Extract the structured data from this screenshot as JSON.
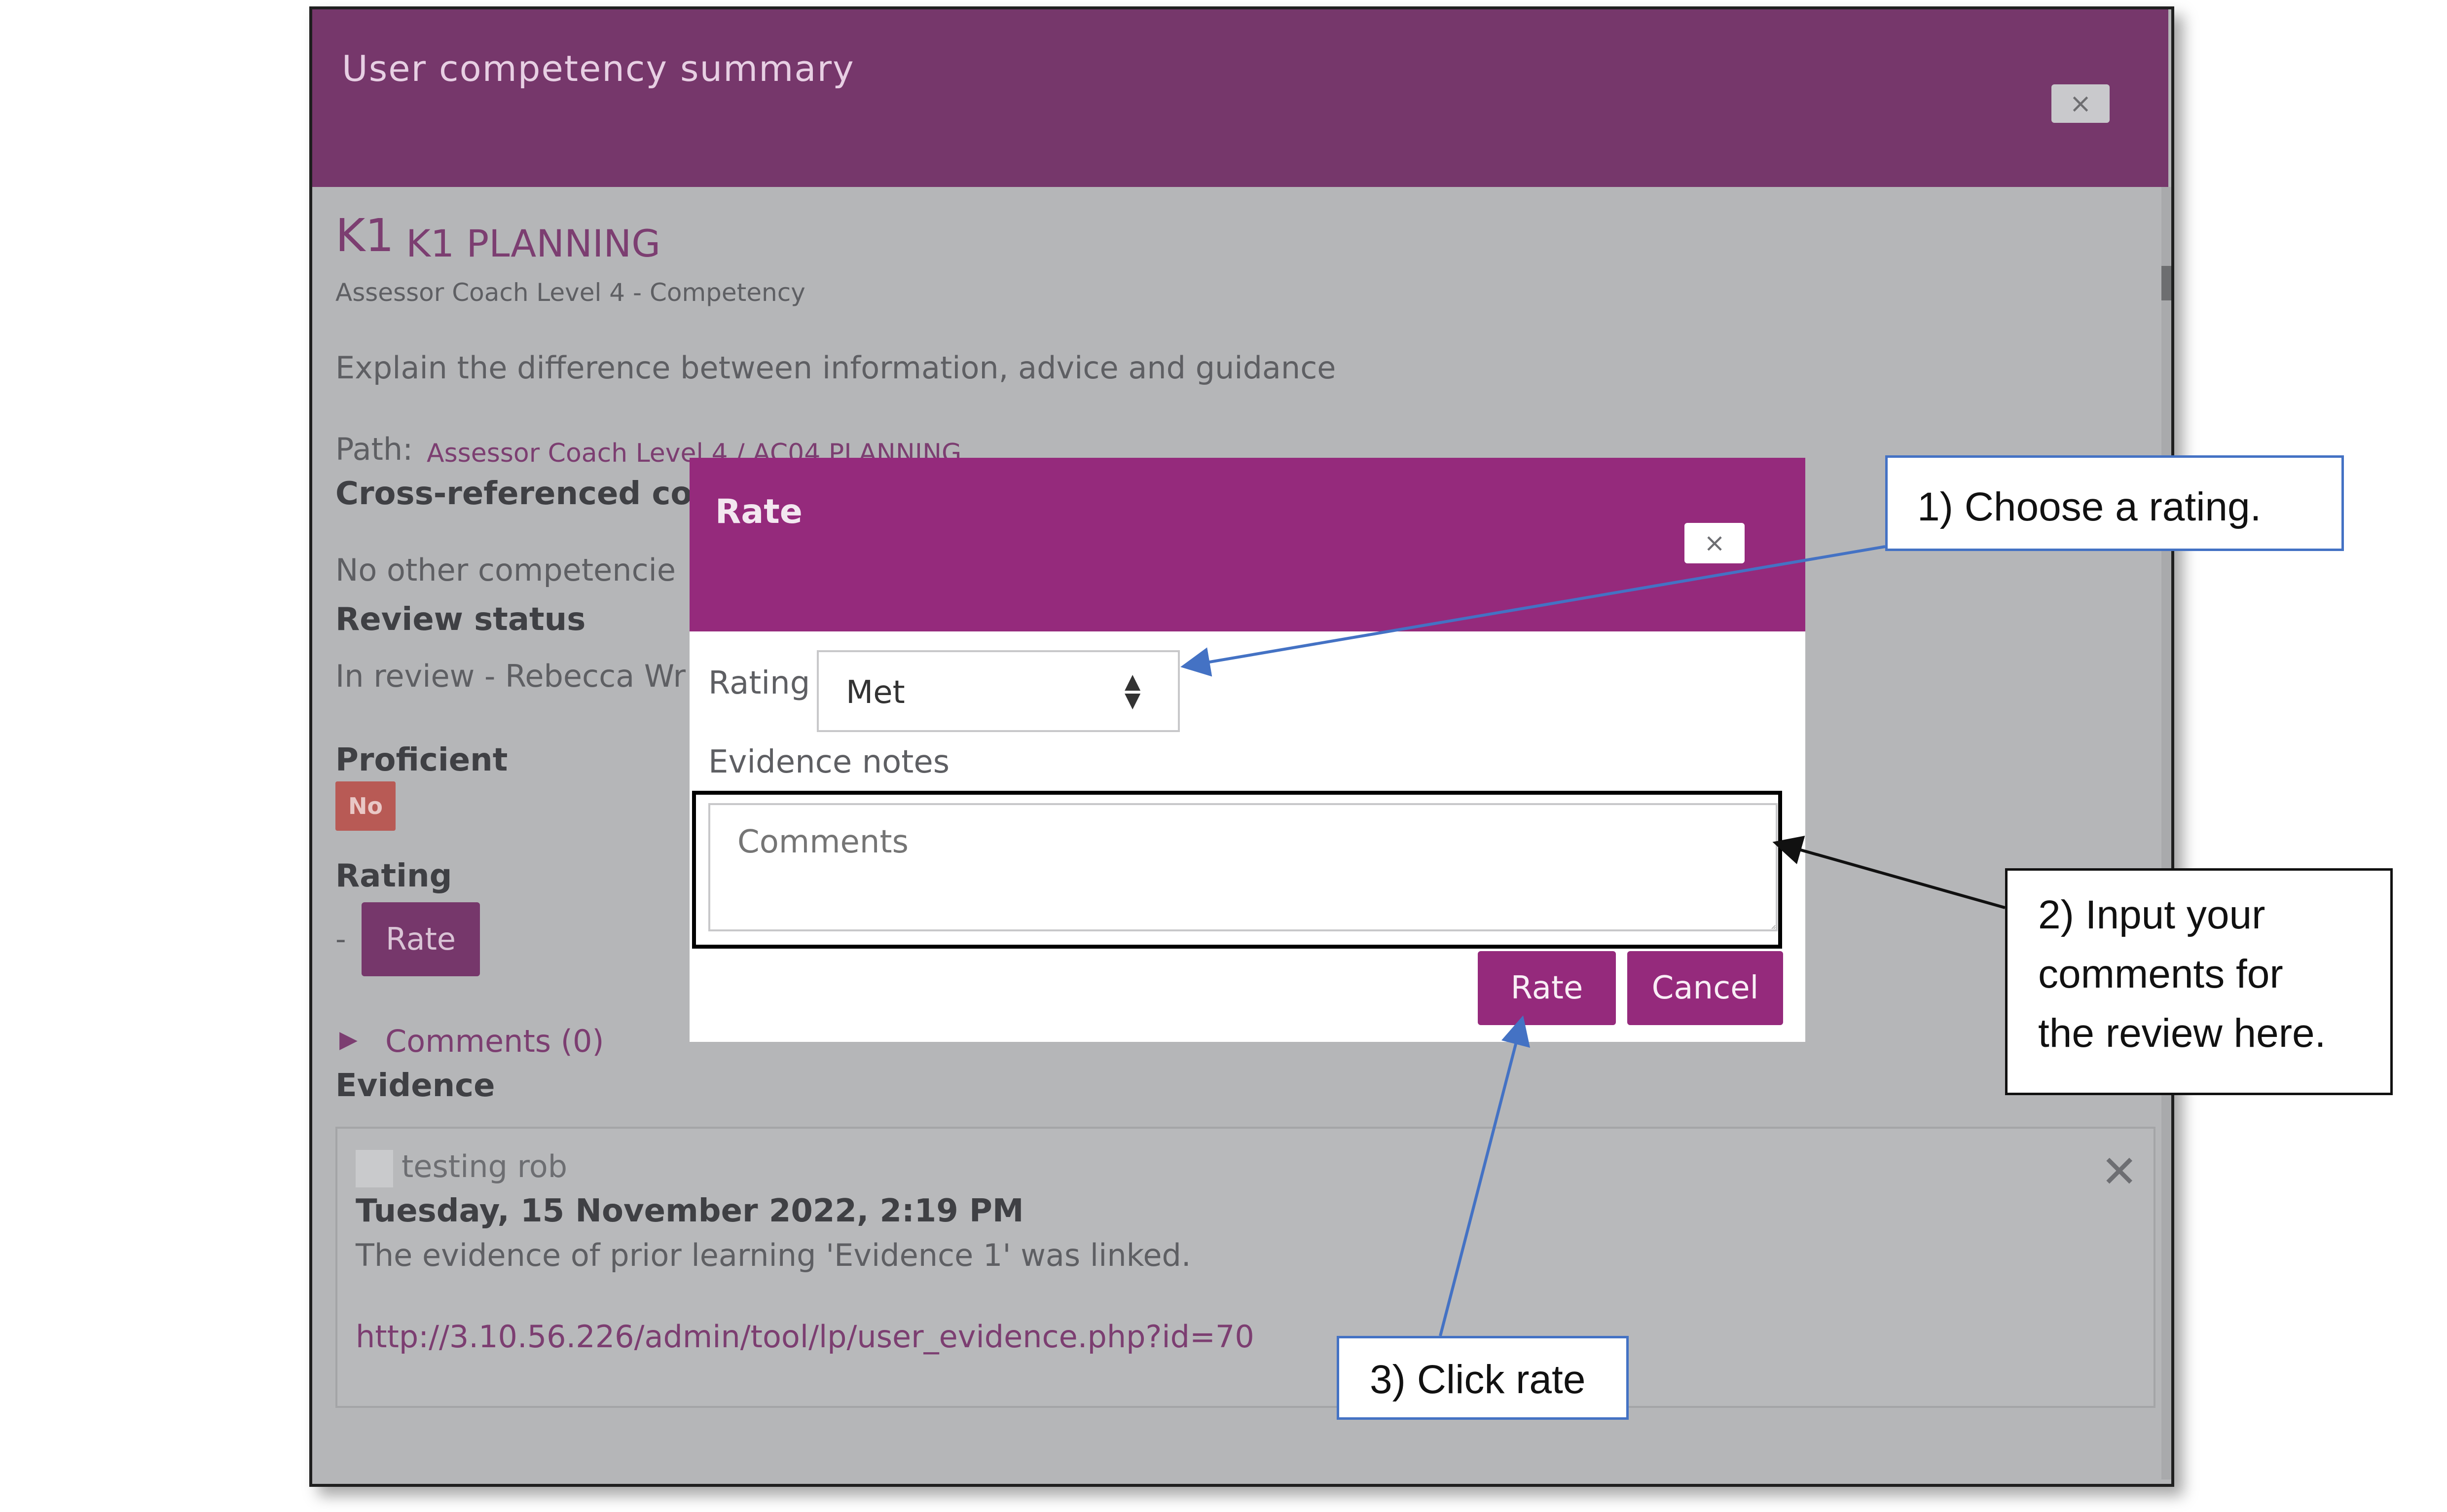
{
  "outer_dialog": {
    "title": "User competency summary",
    "close_label": "×"
  },
  "competency": {
    "code": "K1",
    "name": "K1 PLANNING",
    "framework": "Assessor Coach Level 4 - Competency",
    "description": "Explain the difference between information, advice and guidance",
    "path_label": "Path:",
    "path_value": "Assessor Coach Level 4 / AC04 PLANNING",
    "crossref_label": "Cross-referenced comp",
    "crossref_value": "No other competencie",
    "review_status_label": "Review status",
    "review_status_value": "In review - Rebecca Wr",
    "proficient_label": "Proficient",
    "proficient_value": "No",
    "rating_label": "Rating",
    "rating_value": "-",
    "rate_button": "Rate",
    "comments_link": "Comments (0)",
    "evidence_label": "Evidence"
  },
  "evidence": {
    "user": "testing rob",
    "date": "Tuesday, 15 November 2022, 2:19 PM",
    "description": "The evidence of prior learning 'Evidence 1' was linked.",
    "link": "http://3.10.56.226/admin/tool/lp/user_evidence.php?id=70",
    "close_label": "✕"
  },
  "rate_modal": {
    "title": "Rate",
    "close_label": "×",
    "rating_label": "Rating",
    "rating_selected": "Met",
    "evidence_notes_label": "Evidence notes",
    "comments_placeholder": "Comments",
    "rate_button": "Rate",
    "cancel_button": "Cancel"
  },
  "callouts": {
    "step1": "1) Choose a rating.",
    "step2_line1": "2) Input your",
    "step2_line2": "comments for",
    "step2_line3": "the review here.",
    "step3": "3) Click rate"
  },
  "colors": {
    "outer_header": "#76376b",
    "modal_header": "#952a7c",
    "callout_border": "#4472c4",
    "overlay": "#b5b6b8"
  }
}
